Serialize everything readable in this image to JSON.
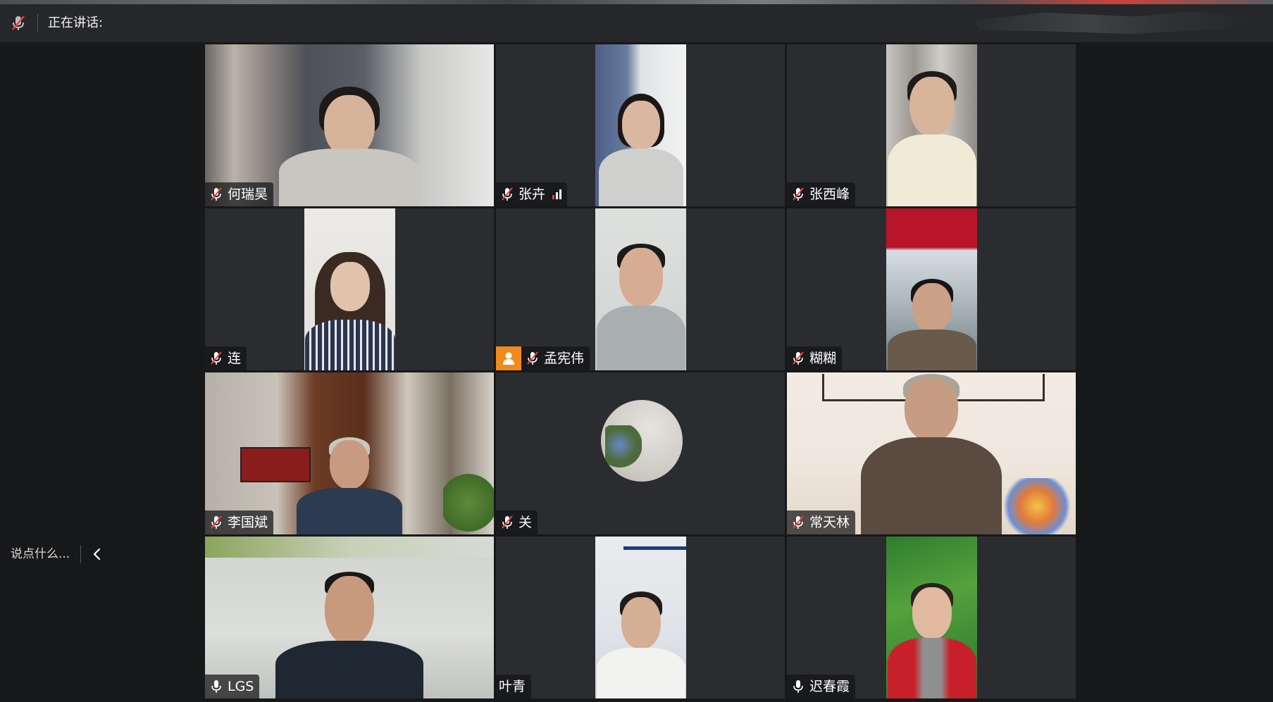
{
  "topbar": {
    "speaking_label": "正在讲话:",
    "mic_icon": "mic-muted-icon"
  },
  "chat": {
    "placeholder": "说点什么...",
    "collapse_icon": "chevron-left-icon"
  },
  "colors": {
    "background": "#17181a",
    "tile_bg": "#2a2c2f",
    "host_badge": "#f08a1c",
    "muted_mic": "#e8433a",
    "active_mic": "#4caf50"
  },
  "participants": [
    {
      "name": "何瑞昊",
      "mic": "muted",
      "video": "full"
    },
    {
      "name": "张卉",
      "mic": "muted",
      "video": "portrait",
      "signal": true
    },
    {
      "name": "张西峰",
      "mic": "muted",
      "video": "portrait"
    },
    {
      "name": "连",
      "mic": "muted",
      "video": "portrait"
    },
    {
      "name": "孟宪伟",
      "mic": "muted",
      "video": "portrait",
      "host": true
    },
    {
      "name": "糊糊",
      "mic": "muted",
      "video": "portrait"
    },
    {
      "name": "李国斌",
      "mic": "muted",
      "video": "full"
    },
    {
      "name": "关",
      "mic": "muted",
      "video": "avatar"
    },
    {
      "name": "常天林",
      "mic": "muted",
      "video": "full"
    },
    {
      "name": "LGS",
      "mic": "on",
      "video": "full"
    },
    {
      "name": "叶青",
      "mic": "none",
      "video": "portrait"
    },
    {
      "name": "迟春霞",
      "mic": "on",
      "video": "portrait"
    }
  ]
}
